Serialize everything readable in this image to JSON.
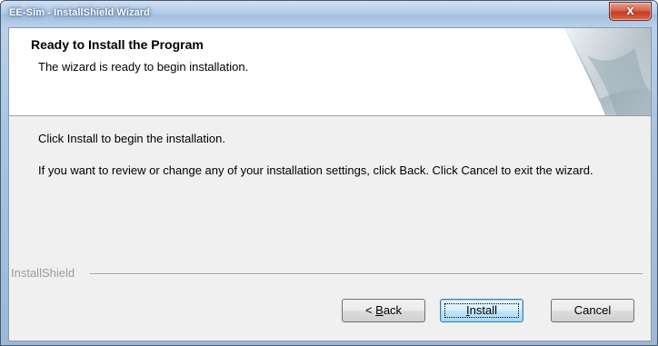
{
  "window": {
    "title": "EE-Sim - InstallShield Wizard",
    "close_glyph": "x"
  },
  "header": {
    "title": "Ready to Install the Program",
    "subtitle": "The wizard is ready to begin installation."
  },
  "body": {
    "line1": "Click Install to begin the installation.",
    "line2": "If you want to review or change any of your installation settings, click Back. Click Cancel to exit the wizard."
  },
  "footer": {
    "brand": "InstallShield"
  },
  "buttons": {
    "back_prefix": "< ",
    "back_mnemonic": "B",
    "back_rest": "ack",
    "install_mnemonic": "I",
    "install_rest": "nstall",
    "cancel": "Cancel"
  },
  "colors": {
    "title_bar": "#b4cce8",
    "close_button": "#c43b22",
    "default_button": "#bee6fd",
    "dialog_background": "#f0f0f0"
  },
  "icons": {
    "close": "close-icon",
    "header_graphic": "page-curl-graphic"
  }
}
